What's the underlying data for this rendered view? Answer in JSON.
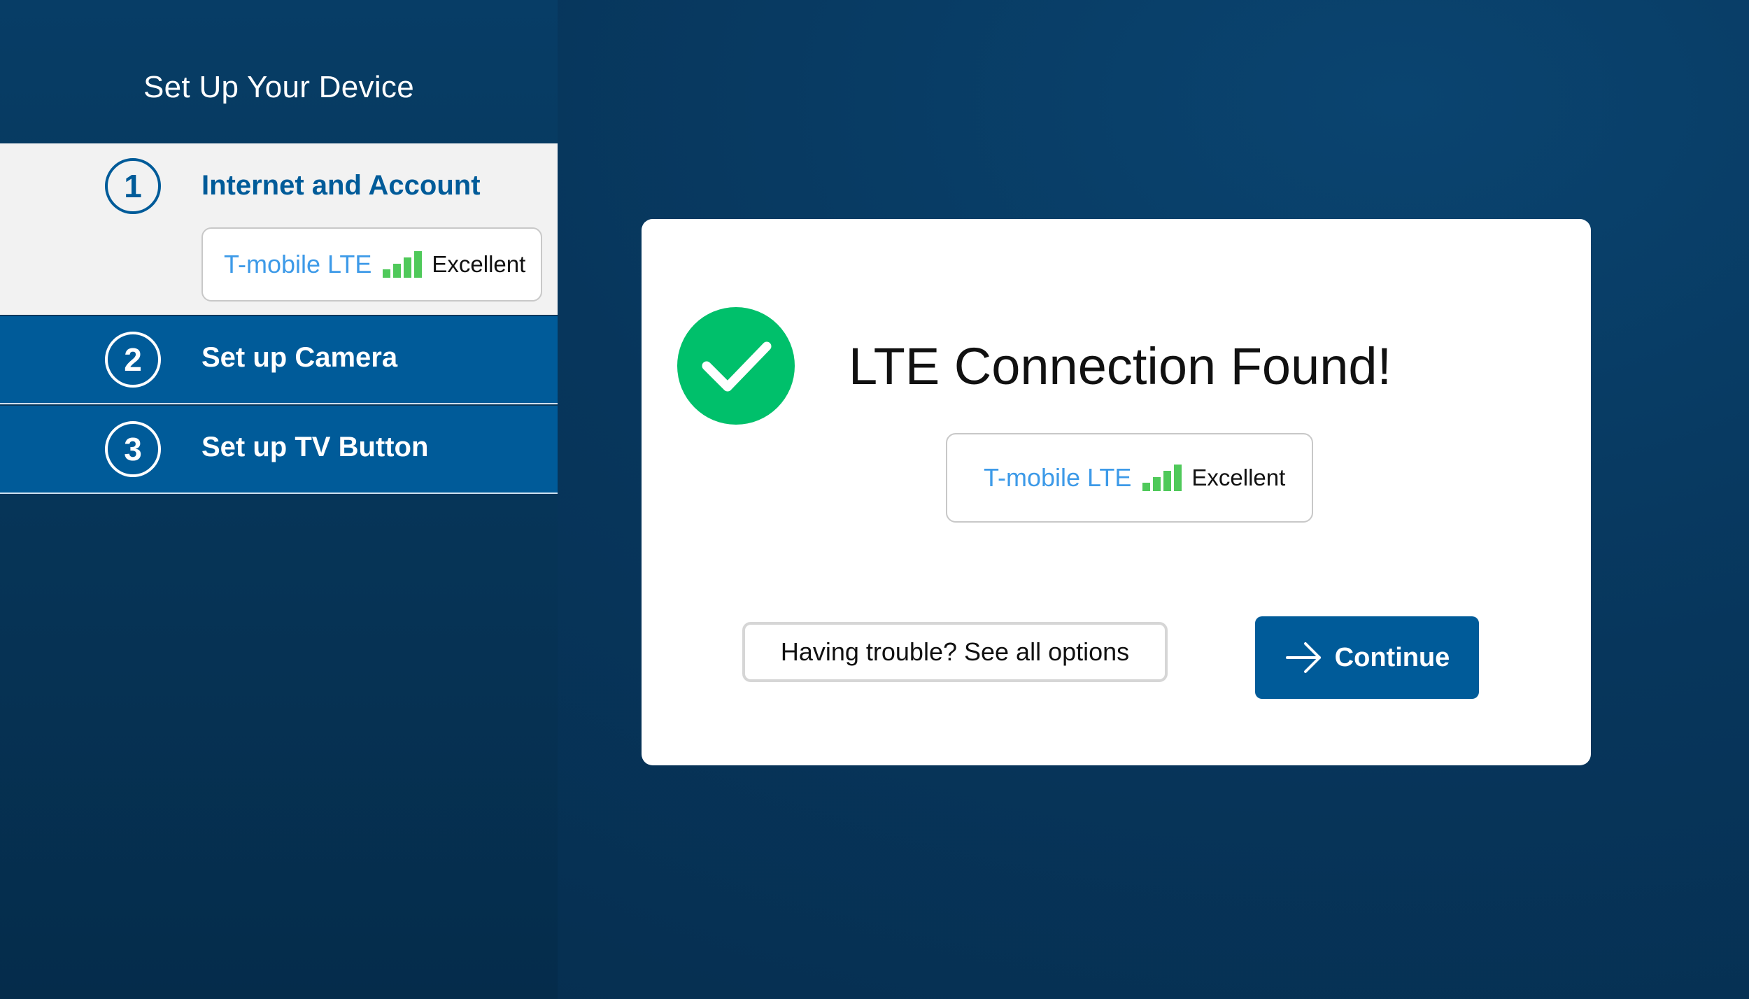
{
  "sidebar": {
    "title": "Set Up Your Device",
    "steps": [
      {
        "number": "1",
        "label": "Internet and Account",
        "active": true,
        "network": {
          "name": "T-mobile LTE",
          "signal_icon": "signal-bars-icon",
          "quality": "Excellent"
        }
      },
      {
        "number": "2",
        "label": "Set up Camera",
        "active": false
      },
      {
        "number": "3",
        "label": "Set up TV Button",
        "active": false
      }
    ]
  },
  "dialog": {
    "status_icon": "check-circle-icon",
    "title": "LTE Connection Found!",
    "network": {
      "name": "T-mobile LTE",
      "signal_icon": "signal-bars-icon",
      "quality": "Excellent"
    },
    "trouble_button_label": "Having trouble? See all options",
    "continue_button": {
      "icon": "arrow-right-icon",
      "label": "Continue"
    }
  },
  "colors": {
    "accent_blue": "#005b99",
    "success_green": "#00c06b",
    "signal_green": "#4fc95a",
    "network_name_blue": "#3d9ae8",
    "background_navy": "#07365c"
  }
}
